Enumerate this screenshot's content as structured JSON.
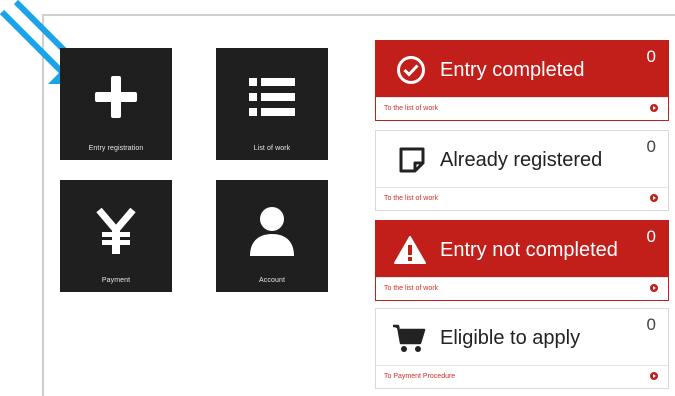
{
  "tiles": [
    {
      "label": "Entry registration",
      "icon": "plus-icon"
    },
    {
      "label": "List of work",
      "icon": "list-icon"
    },
    {
      "label": "Payment",
      "icon": "yen-icon"
    },
    {
      "label": "Account",
      "icon": "user-icon"
    }
  ],
  "cards": [
    {
      "title": "Entry completed",
      "count": "0",
      "link": "To the list of work",
      "icon": "check-circle-icon",
      "style": "red"
    },
    {
      "title": "Already registered",
      "count": "0",
      "link": "To the list of work",
      "icon": "note-icon",
      "style": "white"
    },
    {
      "title": "Entry not completed",
      "count": "0",
      "link": "To the list of work",
      "icon": "warning-icon",
      "style": "red"
    },
    {
      "title": "Eligible to apply",
      "count": "0",
      "link": "To Payment Procedure",
      "icon": "cart-icon",
      "style": "white"
    }
  ],
  "colors": {
    "accent_red": "#c21f1b",
    "tile_bg": "#1f1f1f",
    "pointer_blue": "#1aa3e8"
  }
}
